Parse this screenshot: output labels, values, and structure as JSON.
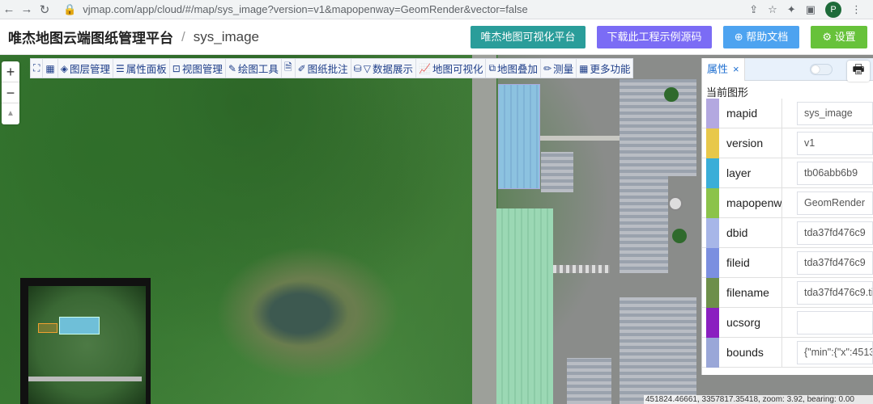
{
  "browser": {
    "url": "vjmap.com/app/cloud/#/map/sys_image?version=v1&mapopenway=GeomRender&vector=false",
    "profile_initial": "P"
  },
  "header": {
    "app_title": "唯杰地图云端图纸管理平台",
    "separator": "/",
    "map_name": "sys_image",
    "buttons": {
      "visual_platform": "唯杰地图可视化平台",
      "download_code": "下载此工程示例源码",
      "help_docs": "帮助文档",
      "settings": "设置"
    }
  },
  "zoom": {
    "in": "+",
    "out": "−",
    "compass": "▲"
  },
  "toolbar": {
    "items": [
      {
        "label": "图层管理",
        "icon": "layers-icon"
      },
      {
        "label": "属性面板",
        "icon": "list-icon"
      },
      {
        "label": "视图管理",
        "icon": "view-icon"
      },
      {
        "label": "绘图工具",
        "icon": "draw-icon"
      },
      {
        "label": "图纸批注",
        "icon": "annotate-icon"
      },
      {
        "label": "数据展示",
        "icon": "filter-icon"
      },
      {
        "label": "地图可视化",
        "icon": "chart-icon"
      },
      {
        "label": "地图叠加",
        "icon": "overlay-icon"
      },
      {
        "label": "测量",
        "icon": "ruler-icon"
      },
      {
        "label": "更多功能",
        "icon": "grid-icon"
      }
    ]
  },
  "panel": {
    "tab_label": "属性",
    "caption": "当前图形",
    "rows": [
      {
        "key": "mapid",
        "value": "sys_image",
        "color": "#b3a8e0"
      },
      {
        "key": "version",
        "value": "v1",
        "color": "#e8c84a"
      },
      {
        "key": "layer",
        "value": "tb06abb6b9",
        "color": "#3aaed8"
      },
      {
        "key": "mapopenway",
        "value": "GeomRender",
        "color": "#8bc34a"
      },
      {
        "key": "dbid",
        "value": "tda37fd476c9",
        "color": "#a7b6e8"
      },
      {
        "key": "fileid",
        "value": "tda37fd476c9",
        "color": "#7b8fe0"
      },
      {
        "key": "filename",
        "value": "tda37fd476c9.ti",
        "color": "#6d8f4a"
      },
      {
        "key": "ucsorg",
        "value": "",
        "color": "#8a1fc0"
      },
      {
        "key": "bounds",
        "value": "{\"min\":{\"x\":4513",
        "color": "#9aa7d8"
      }
    ]
  },
  "status": "451824.46661, 3357817.35418, zoom: 3.92, bearing: 0.00"
}
